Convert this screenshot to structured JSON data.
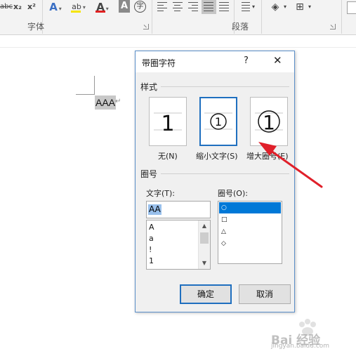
{
  "ribbon": {
    "font_group_label": "字体",
    "paragraph_group_label": "段落",
    "strikethrough": "abc",
    "subscript": "x₂",
    "superscript": "x²",
    "text_effect": "A",
    "highlight": "ab",
    "font_color": "A",
    "char_shading": "A",
    "enclose_char": "字",
    "highlight_color": "#f5e400",
    "font_color_bar": "#e02020"
  },
  "document": {
    "text": "AAA",
    "paragraph_mark": "↵"
  },
  "dialog": {
    "title": "带圈字符",
    "help": "?",
    "close": "✕",
    "style_section": "样式",
    "style_options": [
      {
        "label": "无(N)"
      },
      {
        "label": "缩小文字(S)"
      },
      {
        "label": "增大圈号(E)"
      }
    ],
    "style_glyphs": [
      "1",
      "①",
      "①"
    ],
    "enclose_section": "圈号",
    "text_label": "文字(T):",
    "text_value": "AA",
    "text_list": [
      "A",
      "a",
      "!",
      "1"
    ],
    "enclosure_label": "圈号(O):",
    "enclosure_list": [
      "○",
      "□",
      "△",
      "◇"
    ],
    "ok": "确定",
    "cancel": "取消",
    "accent_color": "#1f6fbf"
  },
  "annotation": {
    "arrow_color": "#e0202a"
  },
  "watermark": {
    "text": "Bai 经验",
    "url": "jingyan.baidu.com"
  }
}
